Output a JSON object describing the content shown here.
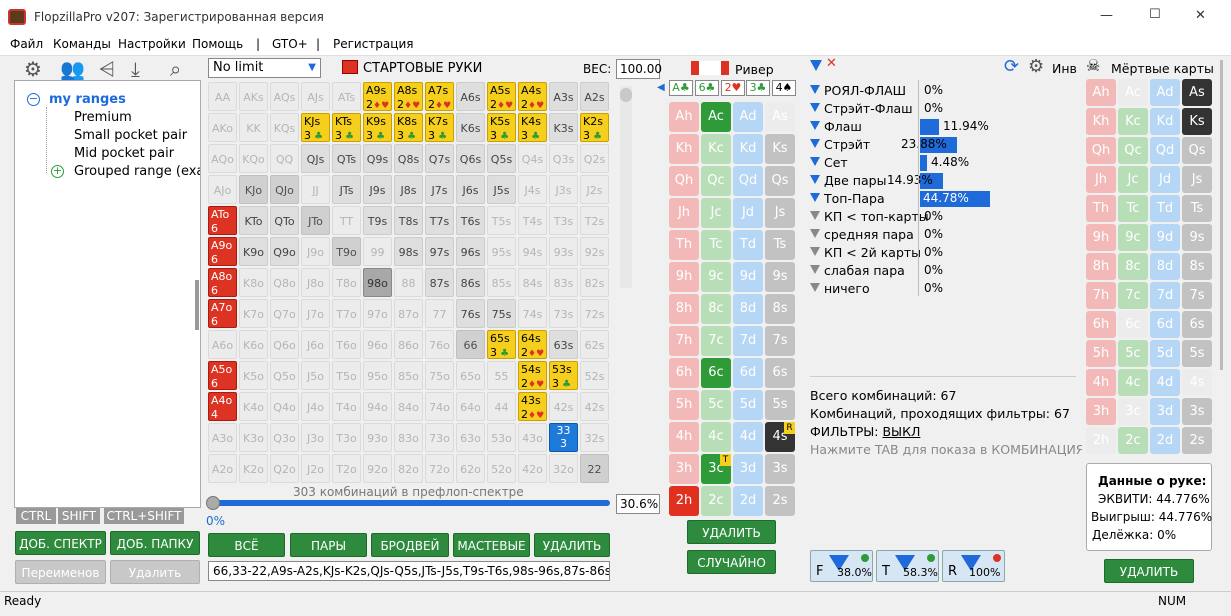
{
  "window": {
    "title": "FlopzillaPro v207: Зарегистрированная версия",
    "minimize": "—",
    "maximize": "☐",
    "close": "✕"
  },
  "menu": [
    "Файл",
    "Команды",
    "Настройки",
    "Помощь",
    "|",
    "GTO+",
    "|",
    "Регистрация"
  ],
  "tree": {
    "root": "my ranges",
    "items": [
      "Premium",
      "Small pocket pair",
      "Mid pocket pair",
      "Grouped range (exar"
    ]
  },
  "modkeys": [
    "CTRL",
    "SHIFT",
    "CTRL+SHIFT"
  ],
  "left_buttons": {
    "add_spectrum": "ДОБ. СПЕКТР",
    "add_folder": "ДОБ. ПАПКУ",
    "rename": "Переименов",
    "delete": "Удалить"
  },
  "range": {
    "limit": "No limit",
    "start_hands": "СТАРТОВЫЕ РУКИ",
    "weight_label": "ВЕС:",
    "weight": "100.00",
    "combos_text": "303 комбинаций в префлоп-спектре",
    "slider_pct": "0%",
    "pct": "30.6%",
    "buttons": [
      "ВСЁ",
      "ПАРЫ",
      "БРОДВЕЙ",
      "МАСТЕВЫЕ",
      "УДАЛИТЬ"
    ],
    "range_text": "66,33-22,A9s-A2s,KJs-K2s,QJs-Q5s,JTs-J5s,T9s-T6s,98s-96s,87s-86s"
  },
  "grid": [
    [
      "AA",
      "AKs",
      "AQs",
      "AJs",
      "ATs",
      "A9s",
      "A8s",
      "A7s",
      "A6s",
      "A5s",
      "A4s",
      "A3s",
      "A2s"
    ],
    [
      "AKo",
      "KK",
      "KQs",
      "KJs",
      "KTs",
      "K9s",
      "K8s",
      "K7s",
      "K6s",
      "K5s",
      "K4s",
      "K3s",
      "K2s"
    ],
    [
      "AQo",
      "KQo",
      "QQ",
      "QJs",
      "QTs",
      "Q9s",
      "Q8s",
      "Q7s",
      "Q6s",
      "Q5s",
      "Q4s",
      "Q3s",
      "Q2s"
    ],
    [
      "AJo",
      "KJo",
      "QJo",
      "JJ",
      "JTs",
      "J9s",
      "J8s",
      "J7s",
      "J6s",
      "J5s",
      "J4s",
      "J3s",
      "J2s"
    ],
    [
      "ATo",
      "KTo",
      "QTo",
      "JTo",
      "TT",
      "T9s",
      "T8s",
      "T7s",
      "T6s",
      "T5s",
      "T4s",
      "T3s",
      "T2s"
    ],
    [
      "A9o",
      "K9o",
      "Q9o",
      "J9o",
      "T9o",
      "99",
      "98s",
      "97s",
      "96s",
      "95s",
      "94s",
      "93s",
      "92s"
    ],
    [
      "A8o",
      "K8o",
      "Q8o",
      "J8o",
      "T8o",
      "98o",
      "88",
      "87s",
      "86s",
      "85s",
      "84s",
      "83s",
      "82s"
    ],
    [
      "A7o",
      "K7o",
      "Q7o",
      "J7o",
      "T7o",
      "97o",
      "87o",
      "77",
      "76s",
      "75s",
      "74s",
      "73s",
      "72s"
    ],
    [
      "A6o",
      "K6o",
      "Q6o",
      "J6o",
      "T6o",
      "96o",
      "86o",
      "76o",
      "66",
      "65s",
      "64s",
      "63s",
      "62s"
    ],
    [
      "A5o",
      "K5o",
      "Q5o",
      "J5o",
      "T5o",
      "95o",
      "85o",
      "75o",
      "65o",
      "55",
      "54s",
      "53s",
      "52s"
    ],
    [
      "A4o",
      "K4o",
      "Q4o",
      "J4o",
      "T4o",
      "94o",
      "84o",
      "74o",
      "64o",
      "44",
      "43s",
      "42s",
      "42s"
    ],
    [
      "A3o",
      "K3o",
      "Q3o",
      "J3o",
      "T3o",
      "93o",
      "83o",
      "73o",
      "63o",
      "53o",
      "43o",
      "33",
      "32s"
    ],
    [
      "A2o",
      "K2o",
      "Q2o",
      "J2o",
      "T2o",
      "92o",
      "82o",
      "72o",
      "62o",
      "52o",
      "42o",
      "32o",
      "22"
    ]
  ],
  "grid_counts": {
    "A9s": "2",
    "A8s": "2",
    "A7s": "2",
    "A5s": "2",
    "A4s": "2",
    "KJs": "3",
    "KTs": "3",
    "K9s": "3",
    "K8s": "3",
    "K7s": "3",
    "K5s": "3",
    "K4s": "3",
    "K2s": "3",
    "ATo": "6",
    "A9o": "6",
    "A8o": "6",
    "A7o": "6",
    "A5o": "6",
    "A4o": "4",
    "65s": "3",
    "64s": "2",
    "54s": "2",
    "53s": "3",
    "43s": "2",
    "33": "3"
  },
  "board": {
    "label": "Ривер",
    "cards": [
      "A♣",
      "6♣",
      "2♥",
      "3♣",
      "4♠"
    ],
    "delete": "УДАЛИТЬ",
    "random": "СЛУЧАЙНО",
    "badge_T": "T",
    "badge_R": "R"
  },
  "deck_ranks": [
    "A",
    "K",
    "Q",
    "J",
    "T",
    "9",
    "8",
    "7",
    "6",
    "5",
    "4",
    "3",
    "2"
  ],
  "stats": [
    {
      "label": "РОЯЛ-ФЛАШ",
      "value": "0%",
      "pct": 0
    },
    {
      "label": "Стрэйт-Флаш",
      "value": "0%",
      "pct": 0
    },
    {
      "label": "Флаш",
      "value": "11.94%",
      "pct": 11.94
    },
    {
      "label": "Стрэйт",
      "value": "23.88%",
      "pct": 23.88
    },
    {
      "label": "Сет",
      "value": "4.48%",
      "pct": 4.48
    },
    {
      "label": "Две пары",
      "value": "14.93%",
      "pct": 14.93
    },
    {
      "label": "Топ-Пара",
      "value": "44.78%",
      "pct": 44.78
    },
    {
      "label": "КП < топ-карты",
      "value": "0%",
      "pct": 0
    },
    {
      "label": "средняя пара",
      "value": "0%",
      "pct": 0
    },
    {
      "label": "КП < 2й карты",
      "value": "0%",
      "pct": 0
    },
    {
      "label": "слабая пара",
      "value": "0%",
      "pct": 0
    },
    {
      "label": "ничего",
      "value": "0%",
      "pct": 0
    }
  ],
  "info": {
    "total": "Всего комбинаций: 67",
    "passing": "Комбинаций, проходящих фильтры: 67",
    "filters_label": "ФИЛЬТРЫ: ",
    "filters_value": "ВЫКЛ",
    "hint": "Нажмите TAB для показа в КОМБИНАЦИЯХ"
  },
  "street_filters": [
    {
      "letter": "F",
      "value": "38.0%"
    },
    {
      "letter": "T",
      "value": "58.3%"
    },
    {
      "letter": "R",
      "value": "100%"
    }
  ],
  "right": {
    "inv": "Инв",
    "dead": "Мёртвые карты",
    "delete": "УДАЛИТЬ",
    "hand_data_title": "Данные о руке:",
    "equity": "ЭКВИТИ: 44.776%",
    "win": "Выигрыш: 44.776%",
    "tie": "Делёжка: 0%"
  },
  "status": {
    "ready": "Ready",
    "num": "NUM"
  },
  "colors": {
    "accent": "#2e8b3e",
    "blue": "#1e6ad8",
    "red": "#dd3322",
    "yellow": "#f5cf1c"
  }
}
